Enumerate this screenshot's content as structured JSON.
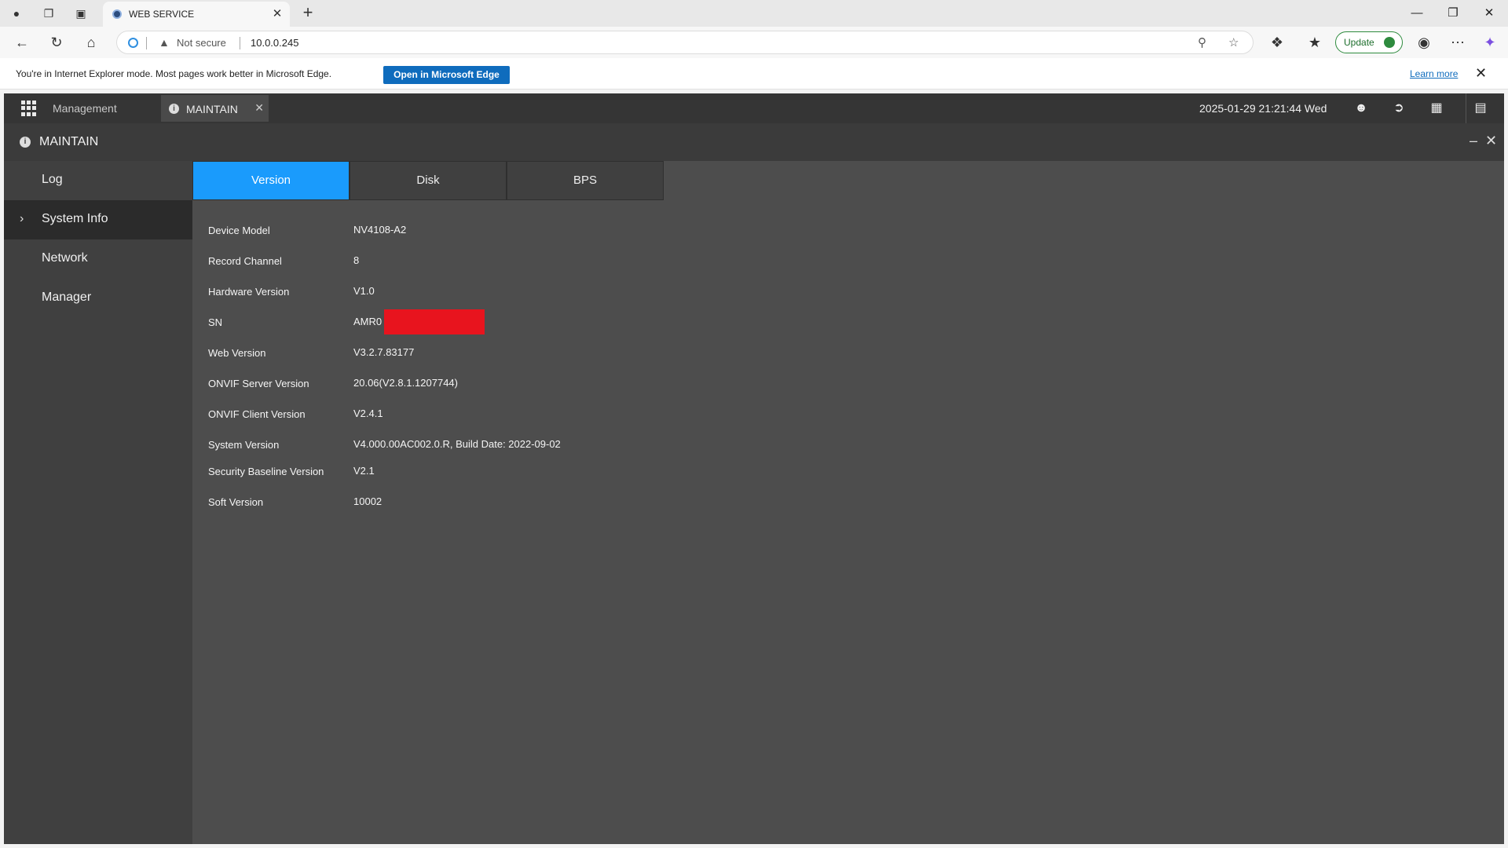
{
  "browser": {
    "tab_title": "WEB SERVICE",
    "not_secure": "Not secure",
    "url": "10.0.0.245",
    "update_label": "Update"
  },
  "infobar": {
    "message": "You're in Internet Explorer mode. Most pages work better in Microsoft Edge.",
    "open_button": "Open in Microsoft Edge",
    "learn_more": "Learn more"
  },
  "app": {
    "management": "Management",
    "tab_title": "MAINTAIN",
    "datetime": "2025-01-29 21:21:44 Wed",
    "window_title": "MAINTAIN"
  },
  "sidebar": {
    "items": [
      {
        "label": "Log",
        "active": false
      },
      {
        "label": "System Info",
        "active": true
      },
      {
        "label": "Network",
        "active": false
      },
      {
        "label": "Manager",
        "active": false
      }
    ]
  },
  "tabs": [
    "Version",
    "Disk",
    "BPS"
  ],
  "active_tab": "Version",
  "accent_color": "#1a9bfc",
  "version_info": [
    {
      "key": "Device Model",
      "value": "NV4108-A2"
    },
    {
      "key": "Record Channel",
      "value": "8"
    },
    {
      "key": "Hardware Version",
      "value": "V1.0"
    },
    {
      "key": "SN",
      "value": "AMR0"
    },
    {
      "key": "Web Version",
      "value": "V3.2.7.83177"
    },
    {
      "key": "ONVIF Server Version",
      "value": "20.06(V2.8.1.1207744)"
    },
    {
      "key": "ONVIF Client Version",
      "value": "V2.4.1"
    },
    {
      "key": "System Version",
      "value": "V4.000.00AC002.0.R, Build Date: 2022-09-02"
    },
    {
      "key": "Security Baseline Version",
      "value": "V2.1"
    },
    {
      "key": "Soft Version",
      "value": "10002"
    }
  ]
}
